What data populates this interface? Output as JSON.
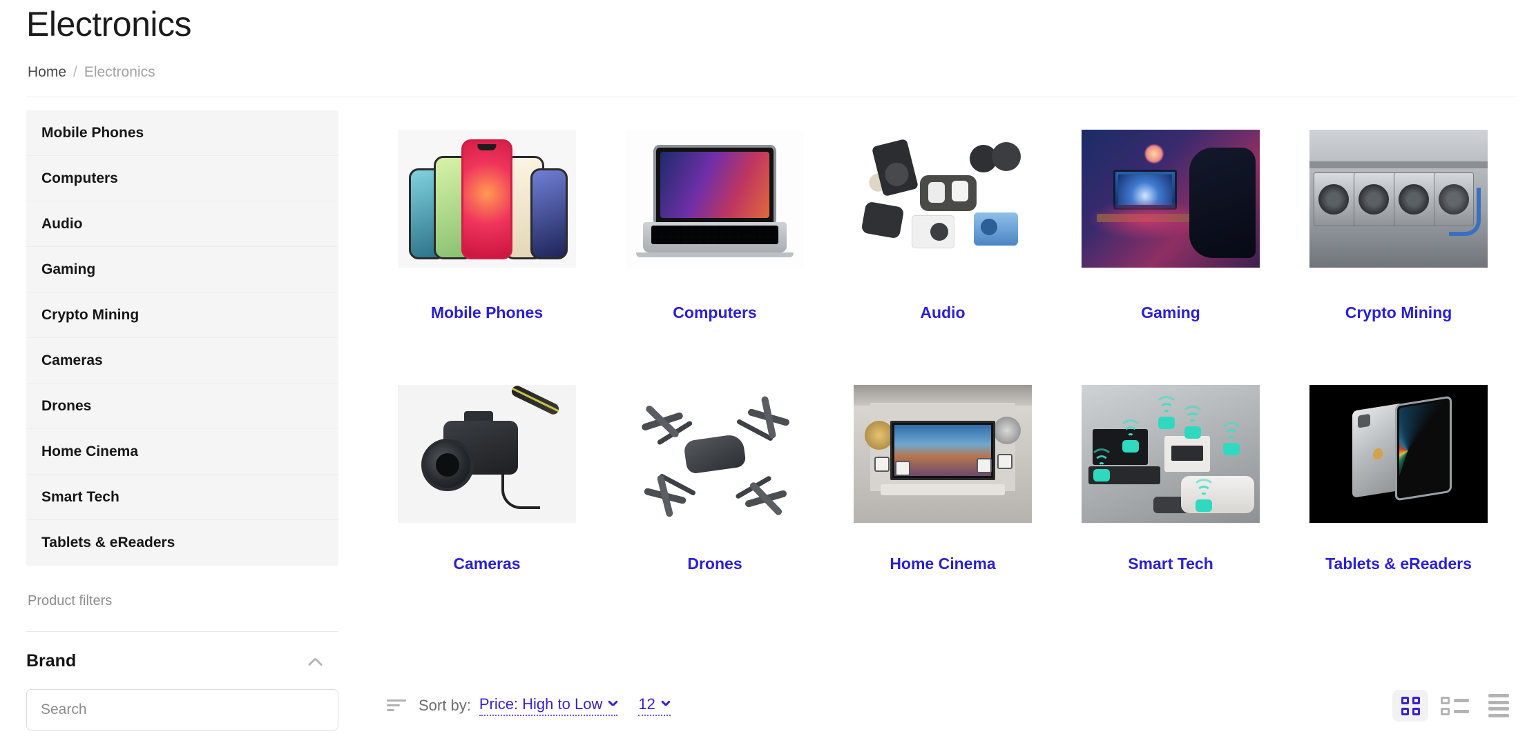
{
  "header": {
    "title": "Electronics",
    "breadcrumb": {
      "home": "Home",
      "separator": "/",
      "current": "Electronics"
    }
  },
  "sidebar": {
    "categories": [
      {
        "label": "Mobile Phones"
      },
      {
        "label": "Computers"
      },
      {
        "label": "Audio"
      },
      {
        "label": "Gaming"
      },
      {
        "label": "Crypto Mining"
      },
      {
        "label": "Cameras"
      },
      {
        "label": "Drones"
      },
      {
        "label": "Home Cinema"
      },
      {
        "label": "Smart Tech"
      },
      {
        "label": "Tablets & eReaders"
      }
    ],
    "filters_label": "Product filters",
    "brand_group": {
      "title": "Brand",
      "collapse_icon": "chevron-up-icon"
    },
    "brand_search": {
      "value": "",
      "placeholder": "Search"
    }
  },
  "main": {
    "tiles": [
      {
        "label": "Mobile Phones",
        "image": "phones-fan-photo"
      },
      {
        "label": "Computers",
        "image": "macbook-laptop-photo"
      },
      {
        "label": "Audio",
        "image": "speakers-earbuds-headphones-photo"
      },
      {
        "label": "Gaming",
        "image": "neon-gaming-room-photo"
      },
      {
        "label": "Crypto Mining",
        "image": "gpu-mining-rig-photo"
      },
      {
        "label": "Cameras",
        "image": "dslr-camera-photo"
      },
      {
        "label": "Drones",
        "image": "fpv-drone-photo"
      },
      {
        "label": "Home Cinema",
        "image": "tv-studio-photo"
      },
      {
        "label": "Smart Tech",
        "image": "smart-home-wifi-photo"
      },
      {
        "label": "Tablets & eReaders",
        "image": "ipad-pro-photo"
      }
    ]
  },
  "toolbar": {
    "sort_icon": "sort-lines-icon",
    "sort_label": "Sort by:",
    "sort_value": "Price: High to Low",
    "page_size_value": "12",
    "views": [
      {
        "name": "grid-view",
        "icon": "grid-icon",
        "active": true
      },
      {
        "name": "list-view",
        "icon": "list-thumbnail-icon",
        "active": false
      },
      {
        "name": "compact-view",
        "icon": "rows-icon",
        "active": false
      }
    ]
  },
  "colors": {
    "link": "#2a1fd6",
    "accent": "#3b1fd0",
    "sidebar_bg": "#f5f5f5",
    "muted_text": "#8d8d8d"
  }
}
